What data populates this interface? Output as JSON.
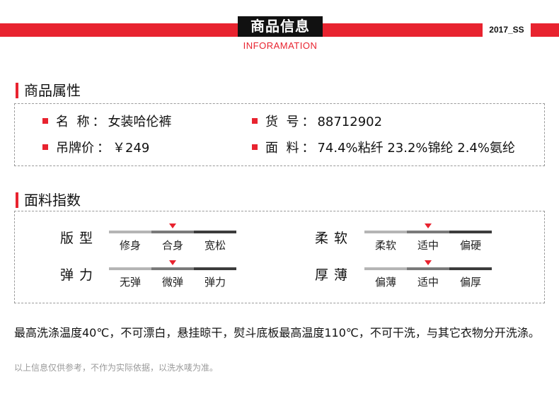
{
  "header": {
    "title": "商品信息",
    "subtitle": "INFORAMATION",
    "season": "2017_SS",
    "accent_color": "#e8232f"
  },
  "attributes": {
    "section_title": "商品属性",
    "items": [
      {
        "label": "名  称",
        "sep": "：",
        "value": "女装哈伦裤"
      },
      {
        "label": "吊牌价",
        "sep": "：",
        "value": "￥249"
      },
      {
        "label": "货  号",
        "sep": "：",
        "value": "88712902"
      },
      {
        "label": "面  料",
        "sep": "：",
        "value": "74.4%粘纤 23.2%锦纶 2.4%氨纶"
      }
    ]
  },
  "fabric_index": {
    "section_title": "面料指数",
    "scales": [
      {
        "label": "版型",
        "options": [
          "修身",
          "合身",
          "宽松"
        ],
        "selected": 1
      },
      {
        "label": "弹力",
        "options": [
          "无弹",
          "微弹",
          "弹力"
        ],
        "selected": 1
      },
      {
        "label": "柔软",
        "options": [
          "柔软",
          "适中",
          "偏硬"
        ],
        "selected": 1
      },
      {
        "label": "厚薄",
        "options": [
          "偏薄",
          "适中",
          "偏厚"
        ],
        "selected": 1
      }
    ]
  },
  "care_instructions": "最高洗涤温度40℃，不可漂白，悬挂晾干，熨斗底板最高温度110℃，不可干洗，与其它衣物分开洗涤。",
  "disclaimer": "以上信息仅供参考，不作为实际依据，以洗水唛为准。"
}
